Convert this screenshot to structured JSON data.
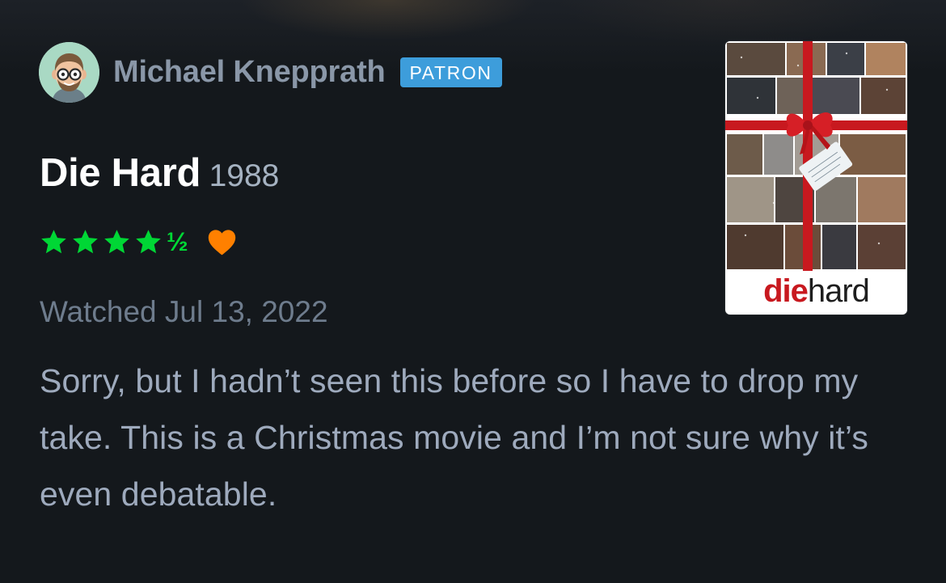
{
  "reviewer": {
    "name": "Michael Knepprath",
    "badge": "PATRON",
    "avatar_icon": "cartoon-face-with-glasses-icon"
  },
  "film": {
    "title": "Die Hard",
    "year": "1988",
    "poster": {
      "logo_part1": "die",
      "logo_part2": "hard"
    }
  },
  "rating": {
    "stars": 4.5,
    "half_symbol": "½",
    "liked": true,
    "star_icon": "star-icon",
    "like_icon": "heart-icon"
  },
  "watched": "Watched Jul 13, 2022",
  "review": {
    "text": "Sorry, but I hadn’t seen this before so I have to drop my take. This is a Christmas movie and I’m not sure why it’s even debatable."
  },
  "colors": {
    "background": "#14181c",
    "star_green": "#00d735",
    "heart_orange": "#ff8000",
    "patron_blue": "#3d9ddb",
    "name_gray": "#8a97a8",
    "body_text": "#9eaabd"
  }
}
